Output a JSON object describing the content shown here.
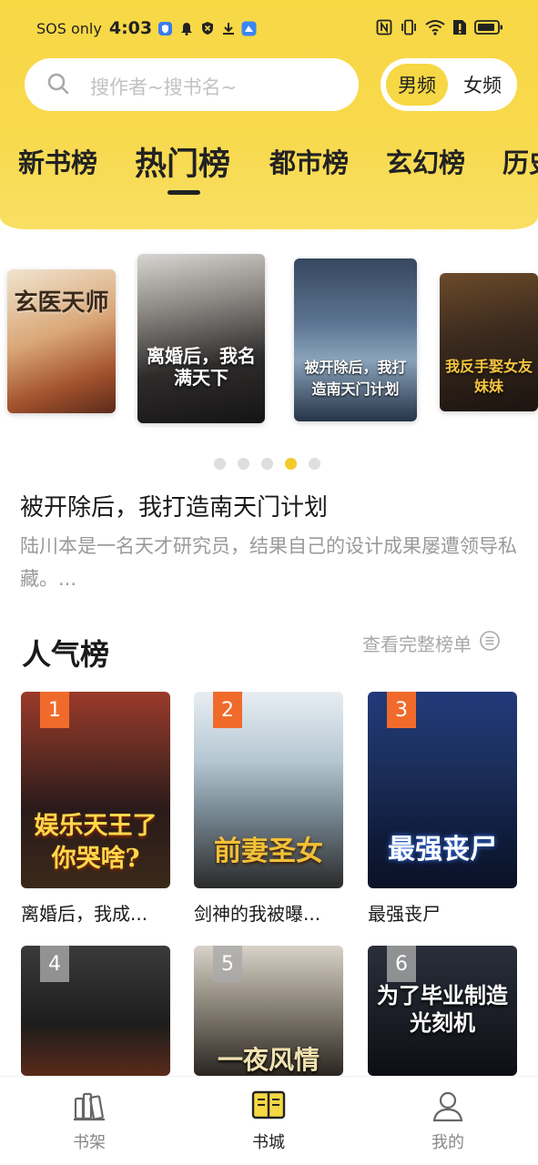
{
  "status_bar": {
    "carrier": "SOS only",
    "time": "4:03"
  },
  "search": {
    "placeholder": "搜作者~搜书名~"
  },
  "gender_toggle": {
    "male": "男频",
    "female": "女频",
    "selected": "男频"
  },
  "tabs": [
    {
      "label": "新书榜"
    },
    {
      "label": "热门榜",
      "active": true
    },
    {
      "label": "都市榜"
    },
    {
      "label": "玄幻榜"
    },
    {
      "label": "历史"
    }
  ],
  "carousel": {
    "covers": [
      {
        "title": "玄医天师"
      },
      {
        "title": "离婚后，我名满天下"
      },
      {
        "title": "被开除后，我打造南天门计划"
      },
      {
        "title": "我反手娶女友妹妹"
      }
    ],
    "dots_count": 5,
    "active_dot": 4
  },
  "featured": {
    "title": "被开除后，我打造南天门计划",
    "description": "陆川本是一名天才研究员，结果自己的设计成果屡遭领导私藏。..."
  },
  "popular": {
    "title": "人气榜",
    "more_label": "查看完整榜单",
    "books": [
      {
        "rank": "1",
        "title": "离婚后，我成...",
        "cover_text": "娱乐天王了你哭啥?"
      },
      {
        "rank": "2",
        "title": "剑神的我被曝...",
        "cover_text": "前妻圣女"
      },
      {
        "rank": "3",
        "title": "最强丧尸",
        "cover_text": "最强丧尸"
      },
      {
        "rank": "4",
        "title": "",
        "cover_text": ""
      },
      {
        "rank": "5",
        "title": "",
        "cover_text": "一夜风情"
      },
      {
        "rank": "6",
        "title": "",
        "cover_text": "为了毕业制造光刻机"
      }
    ]
  },
  "bottom_nav": [
    {
      "label": "书架",
      "icon": "bookshelf-icon"
    },
    {
      "label": "书城",
      "icon": "open-book-icon",
      "active": true
    },
    {
      "label": "我的",
      "icon": "profile-icon"
    }
  ],
  "colors": {
    "accent": "#f6d744",
    "rank_top": "#f06b2b",
    "text_muted": "#9a9a9a"
  }
}
